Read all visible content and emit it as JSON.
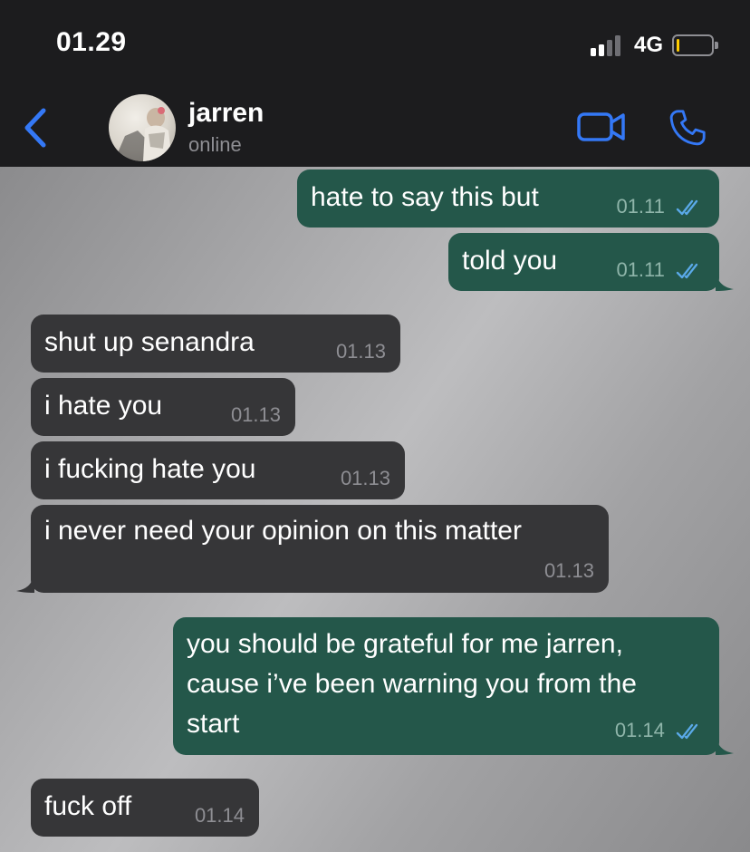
{
  "status_bar": {
    "time": "01.29",
    "network": "4G",
    "signal_bars": 2,
    "battery_fraction": 0.08
  },
  "header": {
    "contact_name": "jarren",
    "contact_status": "online",
    "back_icon": "chevron-left-icon",
    "video_icon": "video-camera-icon",
    "call_icon": "phone-icon"
  },
  "colors": {
    "accent": "#3478f6",
    "outgoing_bubble": "#24574a",
    "incoming_bubble": "#363638",
    "read_ticks": "#5aa9e8",
    "battery_low": "#ffcc00"
  },
  "messages": [
    {
      "direction": "out",
      "lines": [
        "hate to say this but"
      ],
      "time": "01.11",
      "read": true
    },
    {
      "direction": "out",
      "lines": [
        "told you"
      ],
      "time": "01.11",
      "read": true
    },
    {
      "direction": "in",
      "lines": [
        "shut up senandra"
      ],
      "time": "01.13"
    },
    {
      "direction": "in",
      "lines": [
        "i hate you"
      ],
      "time": "01.13"
    },
    {
      "direction": "in",
      "lines": [
        "i fucking hate you"
      ],
      "time": "01.13"
    },
    {
      "direction": "in",
      "lines": [
        "i never need your opinion on this matter"
      ],
      "time": "01.13"
    },
    {
      "direction": "out",
      "lines": [
        "you should be grateful for me jarren,",
        "cause i’ve been warning you from the",
        "start"
      ],
      "time": "01.14",
      "read": true
    },
    {
      "direction": "in",
      "lines": [
        "fuck off"
      ],
      "time": "01.14"
    }
  ]
}
